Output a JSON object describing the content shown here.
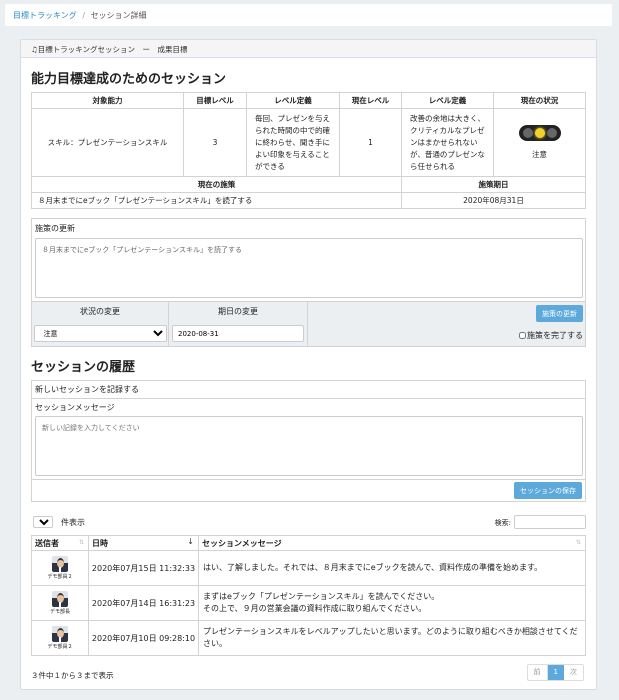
{
  "breadcrumb": {
    "root": "目標トラッキング",
    "separator": "/",
    "current": "セッション詳細"
  },
  "panel": {
    "header": "目標トラッキングセッション　ー　成果目標"
  },
  "session": {
    "title": "能力目標達成のためのセッション",
    "headers": {
      "ability": "対象能力",
      "target_level": "目標レベル",
      "level_def1": "レベル定義",
      "current_level": "現在レベル",
      "level_def2": "レベル定義",
      "status": "現在の状況"
    },
    "ability": "スキル：プレゼンテーションスキル",
    "target_level": "3",
    "target_def": "毎回、プレゼンを与えられた時間の中で的確に終わらせ、聞き手によい印象を与えることができる",
    "current_level": "1",
    "current_def": "改善の余地は大きく、クリティカルなプレゼンはまかせられないが、普通のプレゼンなら任せられる",
    "status_label": "注意",
    "measure_header": "現在の施策",
    "deadline_header": "施策期日",
    "measure": "８月末までにeブック「プレゼンテーションスキル」を読了する",
    "deadline": "2020年08月31日"
  },
  "update": {
    "label": "施策の更新",
    "text": "８月末までにeブック「プレゼンテーションスキル」を読了する",
    "status_change": "状況の変更",
    "status_value": "注意",
    "date_change": "期日の変更",
    "date_value": "2020-08-31",
    "button": "施策の更新",
    "complete": "施策を完了する"
  },
  "history": {
    "title": "セッションの履歴",
    "new_label": "新しいセッションを記録する",
    "msg_label": "セッションメッセージ",
    "placeholder": "新しい記録を入力してください",
    "save": "セッションの保存",
    "length_value": "25",
    "length_suffix": "件表示",
    "search_label": "検索:",
    "columns": {
      "sender": "送信者",
      "date": "日時",
      "message": "セッションメッセージ"
    },
    "rows": [
      {
        "sender": "デモ部員２",
        "date": "2020年07月15日 11:32:33",
        "message": "はい、了解しました。それでは、８月末までにeブックを読んで、資料作成の準備を始めます。"
      },
      {
        "sender": "デモ部長",
        "date": "2020年07月14日 16:31:23",
        "message": "まずはeブック「プレゼンテーションスキル」を読んでください。\nその上で、９月の営業会議の資料作成に取り組んでください。"
      },
      {
        "sender": "デモ部員２",
        "date": "2020年07月10日 09:28:10",
        "message": "プレゼンテーションスキルをレベルアップしたいと思います。どのように取り組むべきか相談させてください。"
      }
    ],
    "info": "３件中１から３まで表示",
    "pagination": {
      "prev": "前",
      "page": "1",
      "next": "次"
    }
  },
  "colors": {
    "accent": "#5da9dc",
    "link": "#2a8ac8",
    "status_light": "#f2d12b"
  }
}
